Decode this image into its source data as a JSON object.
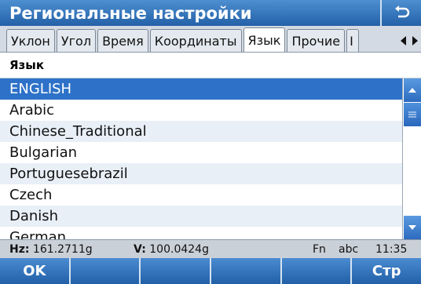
{
  "title": "Региональные настройки",
  "tabs": [
    {
      "label": "Уклон",
      "active": false
    },
    {
      "label": "Угол",
      "active": false
    },
    {
      "label": "Время",
      "active": false
    },
    {
      "label": "Координаты",
      "active": false
    },
    {
      "label": "Язык",
      "active": true
    },
    {
      "label": "Прочие",
      "active": false
    },
    {
      "label": "I",
      "active": false
    }
  ],
  "list_header": "Язык",
  "languages": [
    "ENGLISH",
    "Arabic",
    "Chinese_Traditional",
    "Bulgarian",
    "Portuguesebrazil",
    "Czech",
    "Danish",
    "German"
  ],
  "selected_index": 0,
  "status": {
    "hz_label": "Hz:",
    "hz_value": "161.2711g",
    "v_label": "V:",
    "v_value": "100.0424g",
    "fn": "Fn",
    "input_mode": "abc",
    "time": "11:35"
  },
  "softkeys": [
    "OK",
    "",
    "",
    "",
    "",
    "Стр"
  ],
  "colors": {
    "title_bar": "#2d6bbf",
    "selection": "#2d72c8",
    "alt_row": "#e9eff7"
  }
}
